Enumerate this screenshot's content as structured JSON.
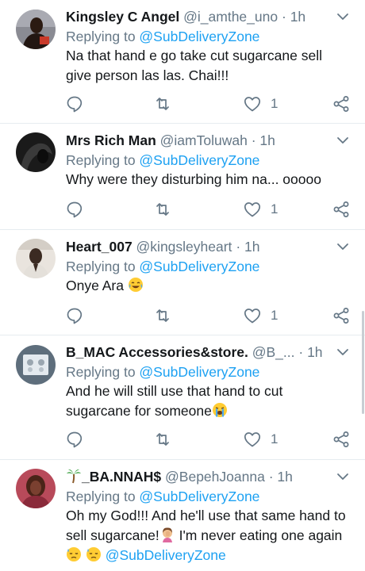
{
  "tweets": [
    {
      "name": "Kingsley C Angel",
      "handle": "@i_amthe_uno",
      "dot": "·",
      "time": "1h",
      "replying_prefix": "Replying to ",
      "replying_to": "@SubDeliveryZone",
      "text_line1": "Na that hand e go take cut sugarcane sell",
      "text_line2": "give person las las. Chai!!!",
      "like_count": "1",
      "avatar": "man-with-bag-avatar",
      "avatar_colors": [
        "#5b5a66",
        "#2a1a14",
        "#c93a2a"
      ]
    },
    {
      "name": "Mrs Rich Man",
      "handle": "@iamToluwah",
      "dot": "·",
      "time": "1h",
      "replying_prefix": "Replying to ",
      "replying_to": "@SubDeliveryZone",
      "text_line1": "Why were they disturbing him na... ooooo",
      "like_count": "1",
      "avatar": "dark-portrait-avatar",
      "avatar_colors": [
        "#111111",
        "#333333"
      ]
    },
    {
      "name": "Heart_007",
      "handle": "@kingsleyheart",
      "dot": "·",
      "time": "1h",
      "replying_prefix": "Replying to ",
      "replying_to": "@SubDeliveryZone",
      "text_line1": "Onye Ara",
      "emoji": "laughing-crying-emoji",
      "like_count": "1",
      "avatar": "man-indoor-avatar",
      "avatar_colors": [
        "#e8e2dc",
        "#3b2a22"
      ]
    },
    {
      "name": "B_MAC Accessories&store.",
      "handle": "@B_...",
      "dot": "·",
      "time": "1h",
      "replying_prefix": "Replying to ",
      "replying_to": "@SubDeliveryZone",
      "text_line1": "And he will still use that hand to cut",
      "text_line2": "sugarcane for someone",
      "emoji": "loudly-crying-emoji",
      "like_count": "1",
      "avatar": "earrings-avatar",
      "avatar_colors": [
        "#6a7a88",
        "#dfe6ec"
      ]
    },
    {
      "name": "_BA.NNAH$",
      "name_prefix_icon": "palm-tree-emoji",
      "handle": "@BepehJoanna",
      "dot": "·",
      "time": "1h",
      "replying_prefix": "Replying to ",
      "replying_to": "@SubDeliveryZone",
      "text_line1": "Oh my God!!! And he'll use that same hand to",
      "text_line2a": "sell sugarcane!",
      "text_line2b": " I'm never eating one again",
      "text_line3_mention": "@SubDeliveryZone",
      "avatar": "woman-red-avatar",
      "avatar_colors": [
        "#8a2a3a",
        "#5a2a1a"
      ]
    }
  ],
  "colors": {
    "text": "#14171a",
    "secondary": "#657786",
    "accent": "#1da1f2",
    "divider": "#e6ecf0"
  },
  "icons": [
    "reply-icon",
    "retweet-icon",
    "like-icon",
    "share-icon",
    "chevron-down-icon"
  ]
}
